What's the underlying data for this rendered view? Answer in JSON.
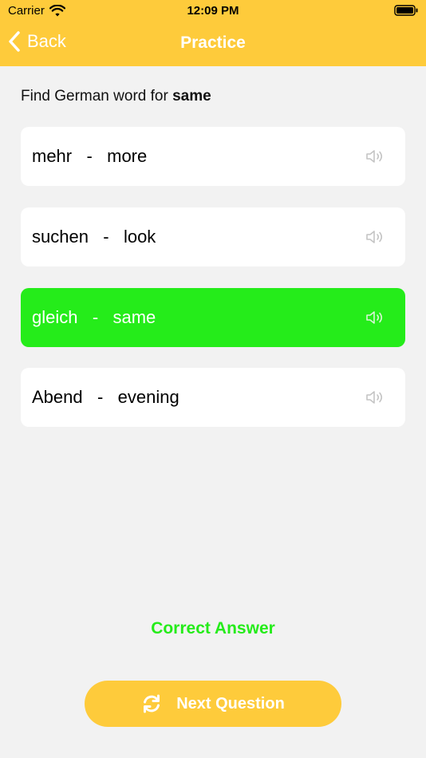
{
  "status_bar": {
    "carrier": "Carrier",
    "time": "12:09 PM",
    "icons": [
      "wifi-icon",
      "battery-icon"
    ]
  },
  "nav": {
    "back_label": "Back",
    "title": "Practice"
  },
  "question": {
    "prompt_prefix": "Find German word for ",
    "target_word": "same"
  },
  "options": [
    {
      "text": "mehr   -   more",
      "state": "default"
    },
    {
      "text": "suchen   -   look",
      "state": "default"
    },
    {
      "text": "gleich   -   same",
      "state": "correct"
    },
    {
      "text": "Abend   -   evening",
      "state": "default"
    }
  ],
  "result_text": "Correct Answer",
  "next_button": {
    "label": "Next Question",
    "icon": "refresh-icon"
  },
  "colors": {
    "accent_yellow": "#fecb3b",
    "correct_green": "#25ec1a",
    "background": "#f2f2f2",
    "card": "#ffffff"
  }
}
